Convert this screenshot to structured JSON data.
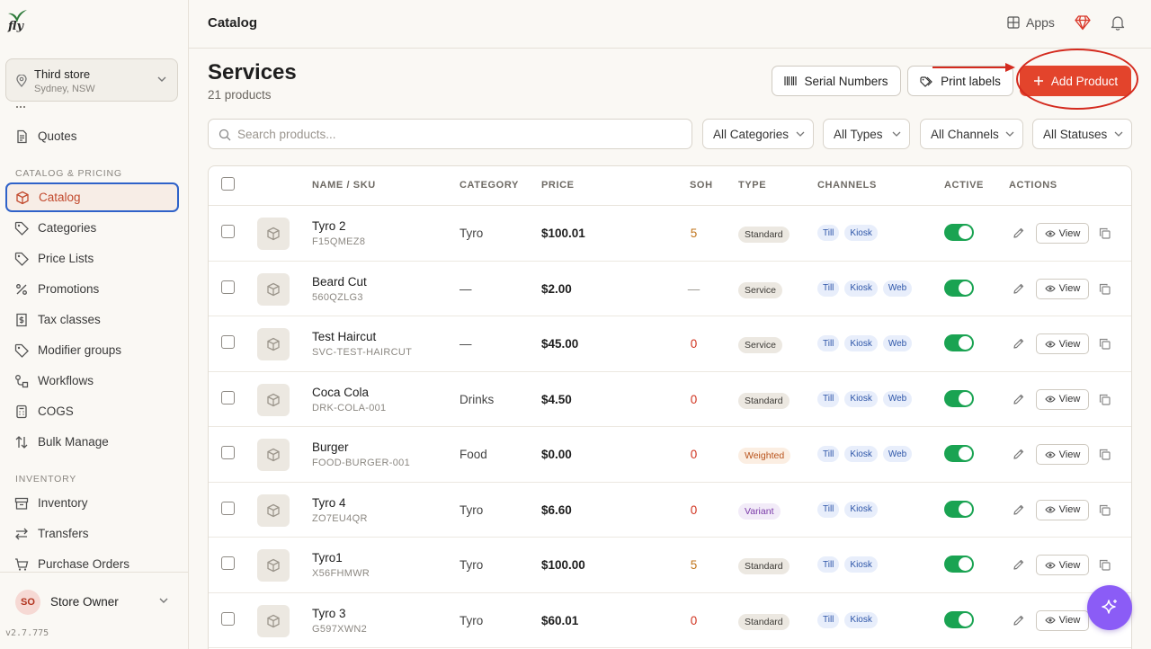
{
  "app": {
    "version": "v2.7.775"
  },
  "store": {
    "name": "Third store",
    "location": "Sydney, NSW"
  },
  "sidebar": {
    "items_top": [
      {
        "label": "Quotes"
      }
    ],
    "sections": [
      {
        "label": "CATALOG & PRICING",
        "items": [
          {
            "label": "Catalog",
            "active": true
          },
          {
            "label": "Categories"
          },
          {
            "label": "Price Lists"
          },
          {
            "label": "Promotions"
          },
          {
            "label": "Tax classes"
          },
          {
            "label": "Modifier groups"
          },
          {
            "label": "Workflows"
          },
          {
            "label": "COGS"
          },
          {
            "label": "Bulk Manage"
          }
        ]
      },
      {
        "label": "INVENTORY",
        "items": [
          {
            "label": "Inventory"
          },
          {
            "label": "Transfers"
          },
          {
            "label": "Purchase Orders"
          }
        ]
      }
    ],
    "user": {
      "initials": "SO",
      "name": "Store Owner"
    }
  },
  "header": {
    "breadcrumb": "Catalog",
    "apps_label": "Apps"
  },
  "page": {
    "title": "Services",
    "count": "21 products",
    "serial_numbers_label": "Serial Numbers",
    "print_labels_label": "Print labels",
    "add_product_label": "Add Product"
  },
  "filters": {
    "search_placeholder": "Search products...",
    "categories": "All Categories",
    "types": "All Types",
    "channels": "All Channels",
    "statuses": "All Statuses"
  },
  "table": {
    "columns": [
      "NAME / SKU",
      "CATEGORY",
      "PRICE",
      "SOH",
      "TYPE",
      "CHANNELS",
      "ACTIVE",
      "ACTIONS"
    ],
    "view_label": "View",
    "rows": [
      {
        "name": "Tyro 2",
        "sku": "F15QMEZ8",
        "category": "Tyro",
        "price": "$100.01",
        "soh": "5",
        "type": "Standard",
        "channels": [
          "Till",
          "Kiosk"
        ],
        "active": true
      },
      {
        "name": "Beard Cut",
        "sku": "560QZLG3",
        "category": "—",
        "price": "$2.00",
        "soh": "—",
        "type": "Service",
        "channels": [
          "Till",
          "Kiosk",
          "Web"
        ],
        "active": true
      },
      {
        "name": "Test Haircut",
        "sku": "SVC-TEST-HAIRCUT",
        "category": "—",
        "price": "$45.00",
        "soh": "0",
        "type": "Service",
        "channels": [
          "Till",
          "Kiosk",
          "Web"
        ],
        "active": true
      },
      {
        "name": "Coca Cola",
        "sku": "DRK-COLA-001",
        "category": "Drinks",
        "price": "$4.50",
        "soh": "0",
        "type": "Standard",
        "channels": [
          "Till",
          "Kiosk",
          "Web"
        ],
        "active": true
      },
      {
        "name": "Burger",
        "sku": "FOOD-BURGER-001",
        "category": "Food",
        "price": "$0.00",
        "soh": "0",
        "type": "Weighted",
        "channels": [
          "Till",
          "Kiosk",
          "Web"
        ],
        "active": true
      },
      {
        "name": "Tyro 4",
        "sku": "ZO7EU4QR",
        "category": "Tyro",
        "price": "$6.60",
        "soh": "0",
        "type": "Variant",
        "channels": [
          "Till",
          "Kiosk"
        ],
        "active": true
      },
      {
        "name": "Tyro1",
        "sku": "X56FHMWR",
        "category": "Tyro",
        "price": "$100.00",
        "soh": "5",
        "type": "Standard",
        "channels": [
          "Till",
          "Kiosk"
        ],
        "active": true
      },
      {
        "name": "Tyro 3",
        "sku": "G597XWN2",
        "category": "Tyro",
        "price": "$60.01",
        "soh": "0",
        "type": "Standard",
        "channels": [
          "Till",
          "Kiosk"
        ],
        "active": true
      }
    ]
  },
  "colors": {
    "accent": "#e3442c",
    "active_nav_text": "#c24a2e",
    "toggle_on": "#1aa352",
    "soh_zero": "#d0321e",
    "soh_positive": "#c0731a",
    "fab": "#8b5cf6",
    "annotation": "#d42b1f"
  },
  "icons": {
    "logo": "fly-logo",
    "store": "map-pin-icon",
    "apps": "grid-icon",
    "gem": "gem-icon",
    "bell": "bell-icon",
    "serial": "barcode-icon",
    "print": "tag-icon",
    "add": "plus-icon",
    "fab": "sparkle-icon"
  }
}
